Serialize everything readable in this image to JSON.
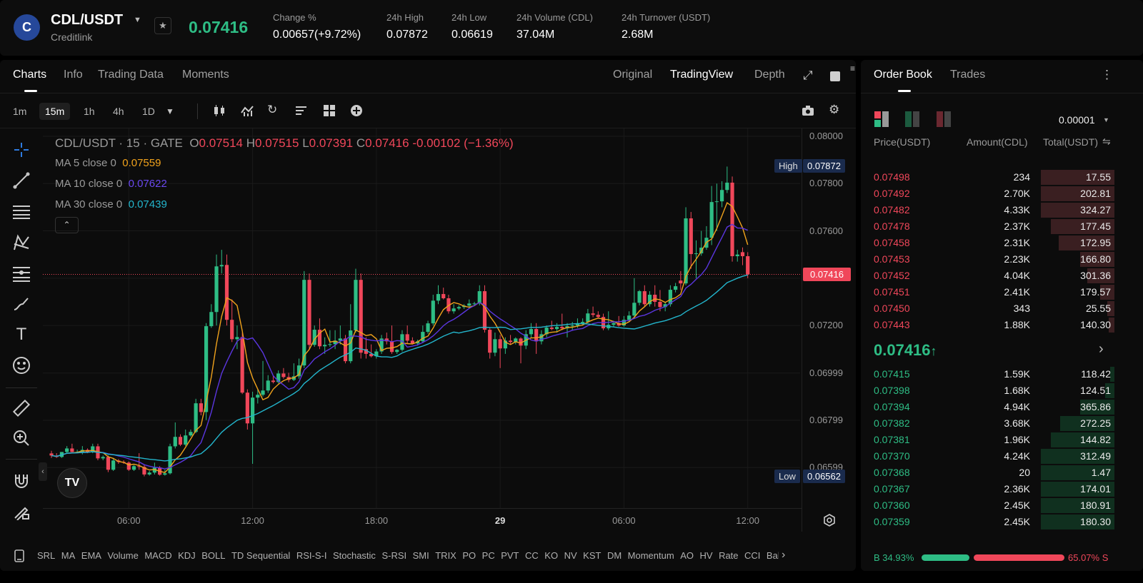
{
  "header": {
    "logo_letter": "C",
    "pair": "CDL/USDT",
    "name": "Creditlink",
    "last_price": "0.07416",
    "stats": [
      {
        "label": "Change %",
        "value": "0.00657(+9.72%)",
        "color": "green"
      },
      {
        "label": "24h High",
        "value": "0.07872"
      },
      {
        "label": "24h Low",
        "value": "0.06619"
      },
      {
        "label": "24h Volume (CDL)",
        "value": "37.04M"
      },
      {
        "label": "24h Turnover (USDT)",
        "value": "2.68M"
      }
    ]
  },
  "chart_tabs": {
    "left": [
      "Charts",
      "Info",
      "Trading Data",
      "Moments"
    ],
    "active": "Charts",
    "right": [
      "Original",
      "TradingView",
      "Depth"
    ],
    "right_active": "TradingView"
  },
  "timeframes": {
    "items": [
      "1m",
      "15m",
      "1h",
      "4h",
      "1D"
    ],
    "active": "15m"
  },
  "legend": {
    "title": "CDL/USDT · 15 · GATE",
    "o_label": "O",
    "o": "0.07514",
    "h_label": "H",
    "h": "0.07515",
    "l_label": "L",
    "l": "0.07391",
    "c_label": "C",
    "c": "0.07416",
    "chg": "-0.00102 (−1.36%)",
    "ma": [
      {
        "label": "MA 5 close 0",
        "value": "0.07559",
        "color": "#f0a21c"
      },
      {
        "label": "MA 10 close 0",
        "value": "0.07622",
        "color": "#5b36e0"
      },
      {
        "label": "MA 30 close 0",
        "value": "0.07439",
        "color": "#23b5cc"
      }
    ]
  },
  "chart_data": {
    "type": "candlestick",
    "interval": "15m",
    "exchange": "GATE",
    "y_ticks": [
      {
        "label": "0.08000",
        "v": 0.08
      },
      {
        "label": "0.07800",
        "v": 0.078
      },
      {
        "label": "0.07600",
        "v": 0.076
      },
      {
        "label": "0.07200",
        "v": 0.072
      },
      {
        "label": "0.06999",
        "v": 0.06999
      },
      {
        "label": "0.06799",
        "v": 0.06799
      },
      {
        "label": "0.06599",
        "v": 0.06599
      }
    ],
    "x_ticks": [
      {
        "label": "06:00",
        "candle": 15
      },
      {
        "label": "12:00",
        "candle": 39
      },
      {
        "label": "18:00",
        "candle": 63
      },
      {
        "label": "29",
        "candle": 87,
        "bold": true
      },
      {
        "label": "06:00",
        "candle": 111
      },
      {
        "label": "12:00",
        "candle": 135
      }
    ],
    "high_marker": {
      "label": "High",
      "value": "0.07872"
    },
    "low_marker": {
      "label": "Low",
      "value": "0.06562"
    },
    "current": {
      "value": "0.07416"
    },
    "ma_periods": [
      5,
      10,
      30
    ],
    "candles_ohlc": [
      [
        0.06659,
        0.0667,
        0.0664,
        0.0665
      ],
      [
        0.0665,
        0.0666,
        0.0664,
        0.06644
      ],
      [
        0.06644,
        0.06665,
        0.0664,
        0.06665
      ],
      [
        0.06665,
        0.0669,
        0.0666,
        0.0668
      ],
      [
        0.0668,
        0.067,
        0.0666,
        0.06665
      ],
      [
        0.06665,
        0.06675,
        0.0666,
        0.06665
      ],
      [
        0.06665,
        0.0669,
        0.06655,
        0.06674
      ],
      [
        0.06674,
        0.0668,
        0.0666,
        0.06665
      ],
      [
        0.06665,
        0.067,
        0.0666,
        0.06689
      ],
      [
        0.06689,
        0.067,
        0.0663,
        0.06638
      ],
      [
        0.06638,
        0.0665,
        0.0663,
        0.06644
      ],
      [
        0.06644,
        0.0665,
        0.0658,
        0.0659
      ],
      [
        0.0659,
        0.0664,
        0.06585,
        0.06629
      ],
      [
        0.06629,
        0.06635,
        0.06615,
        0.06623
      ],
      [
        0.06623,
        0.0663,
        0.06615,
        0.0662
      ],
      [
        0.0662,
        0.06625,
        0.06585,
        0.0659
      ],
      [
        0.0659,
        0.0661,
        0.06585,
        0.06605
      ],
      [
        0.06605,
        0.0666,
        0.0659,
        0.06602
      ],
      [
        0.06602,
        0.0661,
        0.06562,
        0.0657
      ],
      [
        0.0657,
        0.06585,
        0.06565,
        0.06578
      ],
      [
        0.06578,
        0.0662,
        0.0657,
        0.06599
      ],
      [
        0.06599,
        0.06605,
        0.06565,
        0.06569
      ],
      [
        0.06569,
        0.0659,
        0.06565,
        0.06575
      ],
      [
        0.06575,
        0.067,
        0.0657,
        0.06689
      ],
      [
        0.06689,
        0.0679,
        0.0668,
        0.06729
      ],
      [
        0.06729,
        0.0674,
        0.0669,
        0.06696
      ],
      [
        0.06696,
        0.0676,
        0.0669,
        0.06735
      ],
      [
        0.06735,
        0.0676,
        0.0673,
        0.0675
      ],
      [
        0.0675,
        0.0689,
        0.06745,
        0.06871
      ],
      [
        0.06871,
        0.0689,
        0.0682,
        0.06834
      ],
      [
        0.06834,
        0.0721,
        0.068,
        0.07197
      ],
      [
        0.07197,
        0.0729,
        0.0719,
        0.07257
      ],
      [
        0.07257,
        0.075,
        0.072,
        0.0745
      ],
      [
        0.0745,
        0.0752,
        0.0742,
        0.07456
      ],
      [
        0.07456,
        0.075,
        0.072,
        0.07224
      ],
      [
        0.07224,
        0.0731,
        0.0713,
        0.07142
      ],
      [
        0.07142,
        0.072,
        0.071,
        0.07151
      ],
      [
        0.07151,
        0.0717,
        0.0691,
        0.06916
      ],
      [
        0.06916,
        0.0693,
        0.0676,
        0.06786
      ],
      [
        0.06786,
        0.0692,
        0.06615,
        0.06895
      ],
      [
        0.06895,
        0.0693,
        0.0687,
        0.06907
      ],
      [
        0.06907,
        0.0705,
        0.069,
        0.06925
      ],
      [
        0.06925,
        0.0699,
        0.06915,
        0.06967
      ],
      [
        0.06967,
        0.0699,
        0.06955,
        0.06961
      ],
      [
        0.06961,
        0.0701,
        0.06955,
        0.06997
      ],
      [
        0.06997,
        0.0702,
        0.06975,
        0.06982
      ],
      [
        0.06982,
        0.07,
        0.0696,
        0.0697
      ],
      [
        0.0697,
        0.0704,
        0.06965,
        0.06985
      ],
      [
        0.06985,
        0.0706,
        0.06975,
        0.07031
      ],
      [
        0.07031,
        0.0743,
        0.0702,
        0.07393
      ],
      [
        0.07393,
        0.0742,
        0.071,
        0.07118
      ],
      [
        0.07118,
        0.072,
        0.0711,
        0.07182
      ],
      [
        0.07182,
        0.0723,
        0.071,
        0.07112
      ],
      [
        0.07112,
        0.0715,
        0.0708,
        0.07118
      ],
      [
        0.07118,
        0.0718,
        0.0711,
        0.07121
      ],
      [
        0.07121,
        0.0718,
        0.071,
        0.07136
      ],
      [
        0.07136,
        0.072,
        0.0712,
        0.07145
      ],
      [
        0.07145,
        0.0716,
        0.0704,
        0.07049
      ],
      [
        0.07049,
        0.0729,
        0.0704,
        0.07179
      ],
      [
        0.07179,
        0.0744,
        0.0717,
        0.07393
      ],
      [
        0.07393,
        0.0742,
        0.0706,
        0.07085
      ],
      [
        0.071,
        0.0715,
        0.0706,
        0.0708
      ],
      [
        0.0708,
        0.0712,
        0.07065,
        0.0707
      ],
      [
        0.0707,
        0.071,
        0.0706,
        0.0709
      ],
      [
        0.0709,
        0.0716,
        0.0708,
        0.07145
      ],
      [
        0.07145,
        0.0717,
        0.0712,
        0.07133
      ],
      [
        0.07133,
        0.072,
        0.0708,
        0.07088
      ],
      [
        0.07088,
        0.071,
        0.0708,
        0.07097
      ],
      [
        0.07097,
        0.0718,
        0.0709,
        0.07163
      ],
      [
        0.07163,
        0.072,
        0.07125,
        0.07136
      ],
      [
        0.07136,
        0.0715,
        0.0712,
        0.07124
      ],
      [
        0.07124,
        0.0714,
        0.07115,
        0.07133
      ],
      [
        0.07133,
        0.072,
        0.07125,
        0.07173
      ],
      [
        0.07173,
        0.0722,
        0.07165,
        0.07209
      ],
      [
        0.07209,
        0.0733,
        0.072,
        0.07305
      ],
      [
        0.07305,
        0.0737,
        0.0729,
        0.07333
      ],
      [
        0.07333,
        0.0736,
        0.0731,
        0.07315
      ],
      [
        0.07315,
        0.0733,
        0.0725,
        0.0726
      ],
      [
        0.0726,
        0.0729,
        0.0725,
        0.07272
      ],
      [
        0.07272,
        0.07285,
        0.07265,
        0.07278
      ],
      [
        0.07278,
        0.0729,
        0.0727,
        0.07284
      ],
      [
        0.07284,
        0.0731,
        0.07275,
        0.07293
      ],
      [
        0.07293,
        0.073,
        0.07285,
        0.07293
      ],
      [
        0.07293,
        0.0737,
        0.07285,
        0.07345
      ],
      [
        0.07345,
        0.0737,
        0.0717,
        0.07182
      ],
      [
        0.07182,
        0.0719,
        0.0706,
        0.07085
      ],
      [
        0.07085,
        0.0717,
        0.0707,
        0.07142
      ],
      [
        0.07142,
        0.0716,
        0.0702,
        0.07103
      ],
      [
        0.07103,
        0.0715,
        0.0708,
        0.07136
      ],
      [
        0.07136,
        0.0716,
        0.0712,
        0.0713
      ],
      [
        0.0713,
        0.0715,
        0.0712,
        0.07145
      ],
      [
        0.07145,
        0.0715,
        0.0704,
        0.07115
      ],
      [
        0.07115,
        0.0718,
        0.071,
        0.07163
      ],
      [
        0.07163,
        0.0721,
        0.0715,
        0.07185
      ],
      [
        0.07185,
        0.0721,
        0.0708,
        0.07133
      ],
      [
        0.07133,
        0.0718,
        0.0712,
        0.07163
      ],
      [
        0.07163,
        0.072,
        0.0715,
        0.07191
      ],
      [
        0.07191,
        0.0722,
        0.0718,
        0.07185
      ],
      [
        0.07185,
        0.0721,
        0.0717,
        0.07194
      ],
      [
        0.07194,
        0.0725,
        0.0718,
        0.07188
      ],
      [
        0.07188,
        0.0721,
        0.0715,
        0.07197
      ],
      [
        0.07197,
        0.07215,
        0.0718,
        0.072
      ],
      [
        0.072,
        0.0723,
        0.0719,
        0.07209
      ],
      [
        0.07209,
        0.0723,
        0.072,
        0.07215
      ],
      [
        0.07215,
        0.0727,
        0.0721,
        0.07251
      ],
      [
        0.07251,
        0.0728,
        0.07235,
        0.07245
      ],
      [
        0.07245,
        0.0726,
        0.0723,
        0.07236
      ],
      [
        0.07236,
        0.0725,
        0.0718,
        0.07188
      ],
      [
        0.07188,
        0.0726,
        0.0718,
        0.07203
      ],
      [
        0.07203,
        0.0722,
        0.07195,
        0.0721
      ],
      [
        0.0721,
        0.0724,
        0.07195,
        0.072
      ],
      [
        0.072,
        0.0724,
        0.07195,
        0.07224
      ],
      [
        0.07224,
        0.0726,
        0.07215,
        0.07242
      ],
      [
        0.07242,
        0.074,
        0.07235,
        0.07296
      ],
      [
        0.07296,
        0.0735,
        0.07285,
        0.07345
      ],
      [
        0.07345,
        0.0737,
        0.0728,
        0.0729
      ],
      [
        0.0729,
        0.07345,
        0.0728,
        0.0733
      ],
      [
        0.0733,
        0.0737,
        0.0728,
        0.073
      ],
      [
        0.073,
        0.0735,
        0.0726,
        0.07278
      ],
      [
        0.07278,
        0.073,
        0.0726,
        0.0729
      ],
      [
        0.0729,
        0.0737,
        0.0728,
        0.07351
      ],
      [
        0.07351,
        0.0738,
        0.0734,
        0.07366
      ],
      [
        0.0739,
        0.0743,
        0.0735,
        0.07378
      ],
      [
        0.07378,
        0.077,
        0.0737,
        0.07653
      ],
      [
        0.07653,
        0.0768,
        0.0744,
        0.07502
      ],
      [
        0.07502,
        0.0756,
        0.074,
        0.07505
      ],
      [
        0.07505,
        0.076,
        0.07495,
        0.07529
      ],
      [
        0.07529,
        0.0762,
        0.0752,
        0.07571
      ],
      [
        0.07571,
        0.0779,
        0.0754,
        0.07722
      ],
      [
        0.07722,
        0.078,
        0.076,
        0.07725
      ],
      [
        0.07725,
        0.0781,
        0.077,
        0.07773
      ],
      [
        0.07773,
        0.07872,
        0.0776,
        0.07804
      ],
      [
        0.07804,
        0.0783,
        0.0747,
        0.07493
      ],
      [
        0.07493,
        0.0752,
        0.0747,
        0.075
      ],
      [
        0.0751,
        0.0753,
        0.07455,
        0.07493
      ],
      [
        0.07493,
        0.0751,
        0.074,
        0.07416
      ]
    ]
  },
  "indicators": {
    "items": [
      "SRL",
      "MA",
      "EMA",
      "Volume",
      "MACD",
      "KDJ",
      "BOLL",
      "TD Sequential",
      "RSI-S-I",
      "Stochastic",
      "S-RSI",
      "SMI",
      "TRIX",
      "PO",
      "PC",
      "PVT",
      "CC",
      "KO",
      "NV",
      "KST",
      "DM",
      "Momentum",
      "AO",
      "HV",
      "Rate",
      "CCI",
      "Balan"
    ]
  },
  "orderbook": {
    "tabs": [
      "Order Book",
      "Trades"
    ],
    "active": "Order Book",
    "precision": "0.00001",
    "headers": {
      "price": "Price(USDT)",
      "amount": "Amount(CDL)",
      "total": "Total(USDT)"
    },
    "asks": [
      {
        "price": "0.07498",
        "amount": "234",
        "total": "17.55",
        "depth": 1
      },
      {
        "price": "0.07492",
        "amount": "2.70K",
        "total": "202.81",
        "depth": 1
      },
      {
        "price": "0.07482",
        "amount": "4.33K",
        "total": "324.27",
        "depth": 1
      },
      {
        "price": "0.07478",
        "amount": "2.37K",
        "total": "177.45",
        "depth": 0.86
      },
      {
        "price": "0.07458",
        "amount": "2.31K",
        "total": "172.95",
        "depth": 0.76
      },
      {
        "price": "0.07453",
        "amount": "2.23K",
        "total": "166.80",
        "depth": 0.47
      },
      {
        "price": "0.07452",
        "amount": "4.04K",
        "total": "301.36",
        "depth": 0.37
      },
      {
        "price": "0.07451",
        "amount": "2.41K",
        "total": "179.57",
        "depth": 0.19
      },
      {
        "price": "0.07450",
        "amount": "343",
        "total": "25.55",
        "depth": 0.1
      },
      {
        "price": "0.07443",
        "amount": "1.88K",
        "total": "140.30",
        "depth": 0.08
      }
    ],
    "mid_price": "0.07416",
    "mid_arrow": "↑",
    "bids": [
      {
        "price": "0.07415",
        "amount": "1.59K",
        "total": "118.42",
        "depth": 0.06
      },
      {
        "price": "0.07398",
        "amount": "1.68K",
        "total": "124.51",
        "depth": 0.13
      },
      {
        "price": "0.07394",
        "amount": "4.94K",
        "total": "365.86",
        "depth": 0.47
      },
      {
        "price": "0.07382",
        "amount": "3.68K",
        "total": "272.25",
        "depth": 0.74
      },
      {
        "price": "0.07381",
        "amount": "1.96K",
        "total": "144.82",
        "depth": 0.86
      },
      {
        "price": "0.07370",
        "amount": "4.24K",
        "total": "312.49",
        "depth": 1
      },
      {
        "price": "0.07368",
        "amount": "20",
        "total": "1.47",
        "depth": 1
      },
      {
        "price": "0.07367",
        "amount": "2.36K",
        "total": "174.01",
        "depth": 1
      },
      {
        "price": "0.07360",
        "amount": "2.45K",
        "total": "180.91",
        "depth": 1
      },
      {
        "price": "0.07359",
        "amount": "2.45K",
        "total": "180.30",
        "depth": 1
      }
    ],
    "ratio": {
      "buy_label": "B 34.93%",
      "sell_label": "65.07% S",
      "buy_pct": 34.93,
      "sell_pct": 65.07
    }
  },
  "colors": {
    "up": "#2ebd85",
    "down": "#f0475a",
    "bg": "#0c0c0c"
  }
}
